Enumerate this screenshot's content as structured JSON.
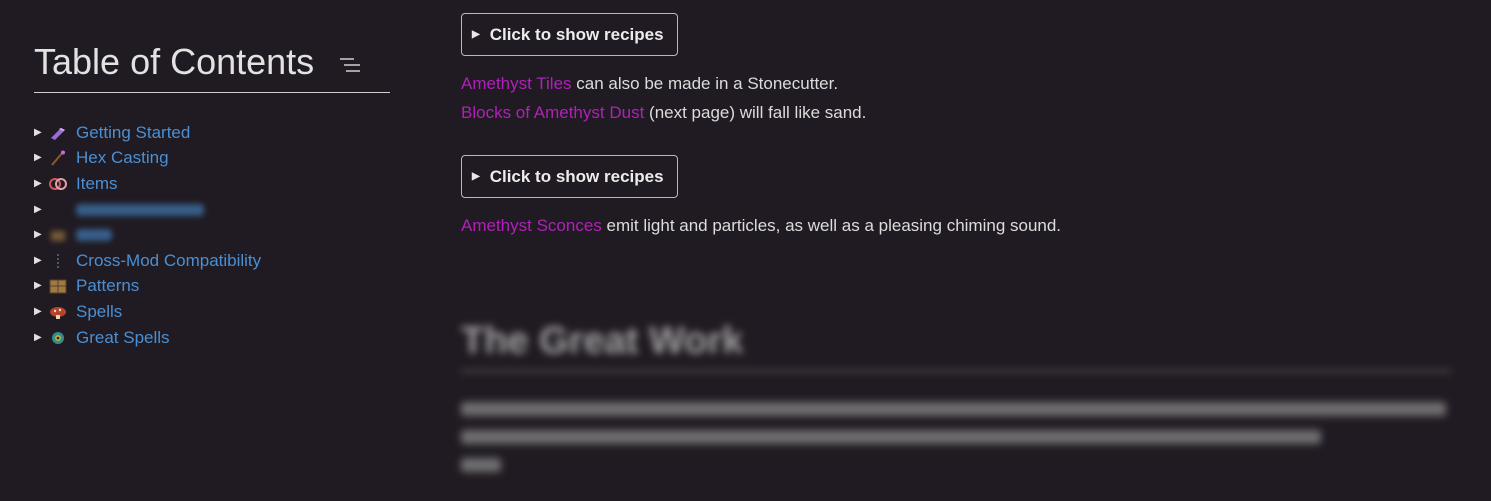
{
  "sidebar": {
    "title": "Table of Contents",
    "items": [
      {
        "label": "Getting Started",
        "icon": "amethyst-shard-icon",
        "obscured": false
      },
      {
        "label": "Hex Casting",
        "icon": "staff-icon",
        "obscured": false
      },
      {
        "label": "Items",
        "icon": "lens-icon",
        "obscured": false
      },
      {
        "label": "",
        "icon": "",
        "obscured": true
      },
      {
        "label": "",
        "icon": "chest-icon",
        "obscured": true
      },
      {
        "label": "Cross-Mod Compatibility",
        "icon": "chain-icon",
        "obscured": false
      },
      {
        "label": "Patterns",
        "icon": "crate-icon",
        "obscured": false
      },
      {
        "label": "Spells",
        "icon": "mushroom-icon",
        "obscured": false
      },
      {
        "label": "Great Spells",
        "icon": "ender-eye-icon",
        "obscured": false
      }
    ]
  },
  "main": {
    "recipe_button_1": "Click to show recipes",
    "para1": {
      "highlight": "Amethyst Tiles",
      "rest": "can also be made in a Stonecutter."
    },
    "para2": {
      "highlight": "Blocks of Amethyst Dust",
      "rest": "(next page) will fall like sand."
    },
    "recipe_button_2": "Click to show recipes",
    "para3": {
      "highlight": "Amethyst Sconces",
      "rest": "emit light and particles, as well as a pleasing chiming sound."
    },
    "obscured_heading": "The Great Work"
  },
  "colors": {
    "background": "#201b22",
    "link": "#4a8fd3",
    "highlight": "#b020b8",
    "text": "#dcdcdc"
  }
}
